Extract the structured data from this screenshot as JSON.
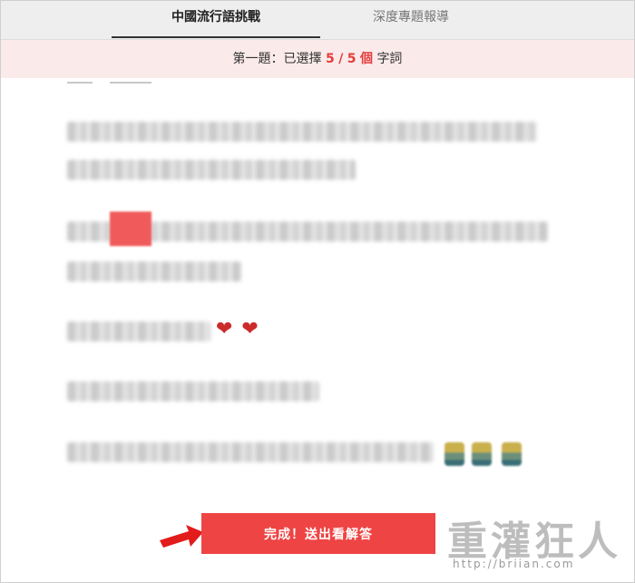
{
  "tabs": [
    {
      "label": "中國流行語挑戰",
      "active": true
    },
    {
      "label": "深度專題報導",
      "active": false
    }
  ],
  "status": {
    "prefix": "第一題：已選擇",
    "selected": "5",
    "separator": "/",
    "total": "5",
    "unit_word": "個",
    "suffix": "字詞"
  },
  "icons": {
    "hearts": "❤❤",
    "arrow": "red-arrow-icon"
  },
  "colors": {
    "accent": "#ef4444",
    "status_bg": "#fbeaea",
    "tab_bg": "#eeeeee"
  },
  "submit": {
    "label": "完成！送出看解答"
  },
  "watermark": {
    "title": "重灌狂人",
    "url": "http://briian.com"
  }
}
